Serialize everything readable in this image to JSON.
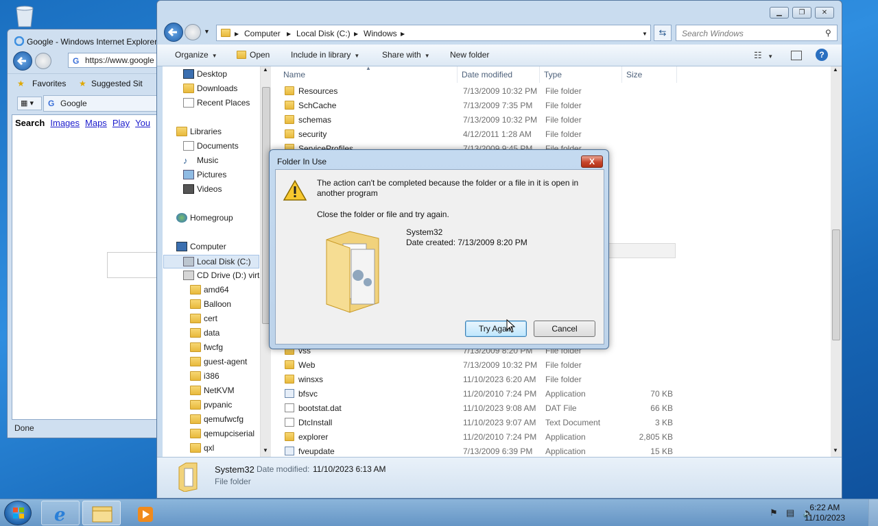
{
  "ie": {
    "title": "Google - Windows Internet Explorer",
    "address": "https://www.google",
    "favorites_label": "Favorites",
    "suggested_label": "Suggested Sit",
    "tab_label": "Google",
    "google_links": [
      "Search",
      "Images",
      "Maps",
      "Play",
      "You"
    ],
    "status": "Done"
  },
  "explorer": {
    "breadcrumb": [
      "Computer",
      "Local Disk (C:)",
      "Windows"
    ],
    "search_placeholder": "Search Windows",
    "commands": {
      "organize": "Organize",
      "open": "Open",
      "include": "Include in library",
      "share": "Share with",
      "newfolder": "New folder"
    },
    "nav": {
      "desktop": "Desktop",
      "downloads": "Downloads",
      "recent": "Recent Places",
      "libraries": "Libraries",
      "documents": "Documents",
      "music": "Music",
      "pictures": "Pictures",
      "videos": "Videos",
      "homegroup": "Homegroup",
      "computer": "Computer",
      "localdisk": "Local Disk (C:)",
      "cddrive": "CD Drive (D:) virt",
      "subfolders": [
        "amd64",
        "Balloon",
        "cert",
        "data",
        "fwcfg",
        "guest-agent",
        "i386",
        "NetKVM",
        "pvpanic",
        "qemufwcfg",
        "qemupciserial",
        "qxl"
      ]
    },
    "columns": {
      "name": "Name",
      "date": "Date modified",
      "type": "Type",
      "size": "Size"
    },
    "files_top": [
      {
        "name": "Resources",
        "date": "7/13/2009 10:32 PM",
        "type": "File folder",
        "size": ""
      },
      {
        "name": "SchCache",
        "date": "7/13/2009 7:35 PM",
        "type": "File folder",
        "size": ""
      },
      {
        "name": "schemas",
        "date": "7/13/2009 10:32 PM",
        "type": "File folder",
        "size": ""
      },
      {
        "name": "security",
        "date": "4/12/2011 1:28 AM",
        "type": "File folder",
        "size": ""
      },
      {
        "name": "ServiceProfiles",
        "date": "7/13/2009 9:45 PM",
        "type": "File folder",
        "size": ""
      }
    ],
    "files_bottom": [
      {
        "name": "vss",
        "date": "7/13/2009 8:20 PM",
        "type": "File folder",
        "size": "",
        "icon": "folder"
      },
      {
        "name": "Web",
        "date": "7/13/2009 10:32 PM",
        "type": "File folder",
        "size": "",
        "icon": "folder"
      },
      {
        "name": "winsxs",
        "date": "11/10/2023 6:20 AM",
        "type": "File folder",
        "size": "",
        "icon": "folder"
      },
      {
        "name": "bfsvc",
        "date": "11/20/2010 7:24 PM",
        "type": "Application",
        "size": "70 KB",
        "icon": "app"
      },
      {
        "name": "bootstat.dat",
        "date": "11/10/2023 9:08 AM",
        "type": "DAT File",
        "size": "66 KB",
        "icon": "doc"
      },
      {
        "name": "DtcInstall",
        "date": "11/10/2023 9:07 AM",
        "type": "Text Document",
        "size": "3 KB",
        "icon": "doc"
      },
      {
        "name": "explorer",
        "date": "11/20/2010 7:24 PM",
        "type": "Application",
        "size": "2,805 KB",
        "icon": "folder"
      },
      {
        "name": "fveupdate",
        "date": "7/13/2009 6:39 PM",
        "type": "Application",
        "size": "15 KB",
        "icon": "app"
      }
    ],
    "details": {
      "name": "System32",
      "modified_label": "Date modified:",
      "modified": "11/10/2023 6:13 AM",
      "type": "File folder"
    }
  },
  "dialog": {
    "title": "Folder In Use",
    "message": "The action can't be completed because the folder or a file in it is open in another program",
    "instruction": "Close the folder or file and try again.",
    "item_name": "System32",
    "item_date": "Date created: 7/13/2009 8:20 PM",
    "try_again": "Try Again",
    "cancel": "Cancel",
    "close_glyph": "X"
  },
  "taskbar": {
    "time": "6:22 AM",
    "date": "11/10/2023"
  },
  "colors": {
    "accent": "#3c7fb1",
    "close_red": "#c7452c",
    "folder_yellow": "#e8b93c"
  }
}
